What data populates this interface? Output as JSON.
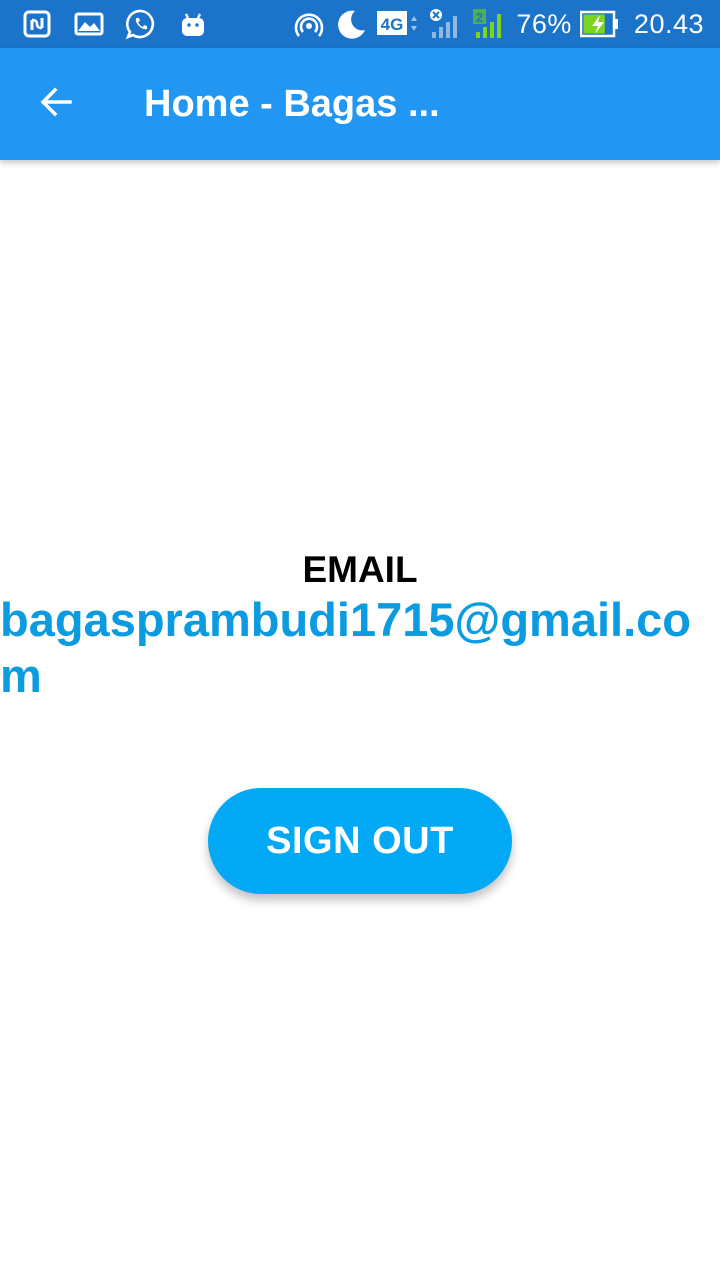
{
  "status_bar": {
    "left_icons": [
      "nfc-icon",
      "gallery-icon",
      "whatsapp-icon",
      "android-icon"
    ],
    "right_icons": [
      "hotspot-icon",
      "moon-icon",
      "network-4g-icon",
      "signal-sim1-icon",
      "signal-sim2-icon"
    ],
    "network_label": "4G",
    "sim2_badge": "2",
    "battery_percent": "76%",
    "battery_level": 0.76,
    "charging": true,
    "time": "20.43"
  },
  "app_bar": {
    "title": "Home -  Bagas ...",
    "back_icon": "arrow-back-icon",
    "color": "#2196f3"
  },
  "main": {
    "email_label": "EMAIL",
    "email_value": "bagasprambudi1715@gmail.com",
    "signout_label": "SIGN OUT"
  },
  "colors": {
    "status_bar": "#1b74c9",
    "app_bar": "#2196f3",
    "email_text": "#0a9be0",
    "button": "#03a9f4"
  }
}
